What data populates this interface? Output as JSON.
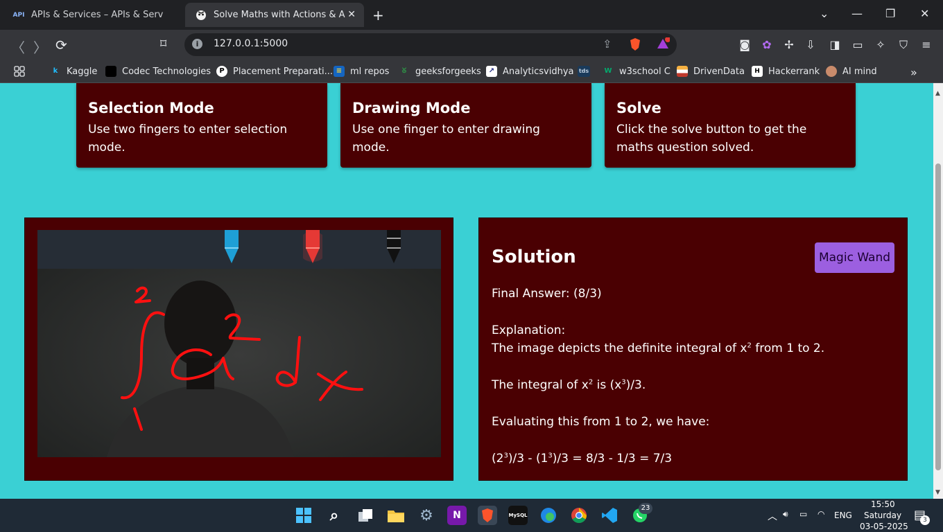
{
  "browser": {
    "tabs": [
      {
        "label": "APIs & Services – APIs & Services – ",
        "favicon": "API",
        "active": false
      },
      {
        "label": "Solve Maths with Actions & AI",
        "favicon": "brave-face-icon",
        "active": true
      }
    ],
    "url": "127.0.0.1:5000",
    "bookmarks": [
      {
        "label": "Kaggle",
        "icon": "k"
      },
      {
        "label": "Codec Technologies",
        "icon": "codec"
      },
      {
        "label": "Placement Preparati...",
        "icon": "P"
      },
      {
        "label": "ml repos",
        "icon": "db"
      },
      {
        "label": "geeksforgeeks",
        "icon": "GG"
      },
      {
        "label": "Analyticsvidhya",
        "icon": "chart"
      },
      {
        "label": "tds",
        "icon": "tds"
      },
      {
        "label": "w3school C",
        "icon": "w3"
      },
      {
        "label": "DrivenData",
        "icon": "dd"
      },
      {
        "label": "Hackerrank",
        "icon": "H"
      },
      {
        "label": "AI mind",
        "icon": "brain"
      }
    ],
    "brave_badge": "1",
    "rewards_badge": "1"
  },
  "cards": [
    {
      "title": "Selection Mode",
      "text": "Use two fingers to enter selection mode."
    },
    {
      "title": "Drawing Mode",
      "text": "Use one finger to enter drawing mode."
    },
    {
      "title": "Solve",
      "text": "Click the solve button to get the maths question solved."
    }
  ],
  "solution": {
    "title": "Solution",
    "button": "Magic Wand",
    "final_answer": "Final Answer: (8/3)",
    "explanation_label": "Explanation:",
    "line1_pre": "The image depicts the definite integral of x",
    "line1_sup": "2",
    "line1_post": " from 1 to 2.",
    "line2_pre": "The integral of x",
    "line2_sup": "2",
    "line2_mid": " is (x",
    "line2_sup2": "3",
    "line2_post": ")/3.",
    "line3": "Evaluating this from 1 to 2, we have:",
    "line4_a": "(2",
    "line4_sup1": "3",
    "line4_b": ")/3 - (1",
    "line4_sup2": "3",
    "line4_c": ")/3 = 8/3 - 1/3 = 7/3"
  },
  "drawing": {
    "strokes_color": "#ff1010",
    "upper_limit": "2",
    "lower_limit": "1",
    "exponent": "2",
    "marker_colors": [
      "#1e9fd6",
      "#e53935",
      "#111111"
    ]
  },
  "taskbar": {
    "whatsapp_badge": "23",
    "lang": "ENG",
    "time": "15:50",
    "day": "Saturday",
    "date": "03-05-2025",
    "notif_count": "3"
  },
  "colors": {
    "page_bg": "#3ad0d4",
    "panel_bg": "#4a0002",
    "button_bg": "#9c5fe0"
  }
}
